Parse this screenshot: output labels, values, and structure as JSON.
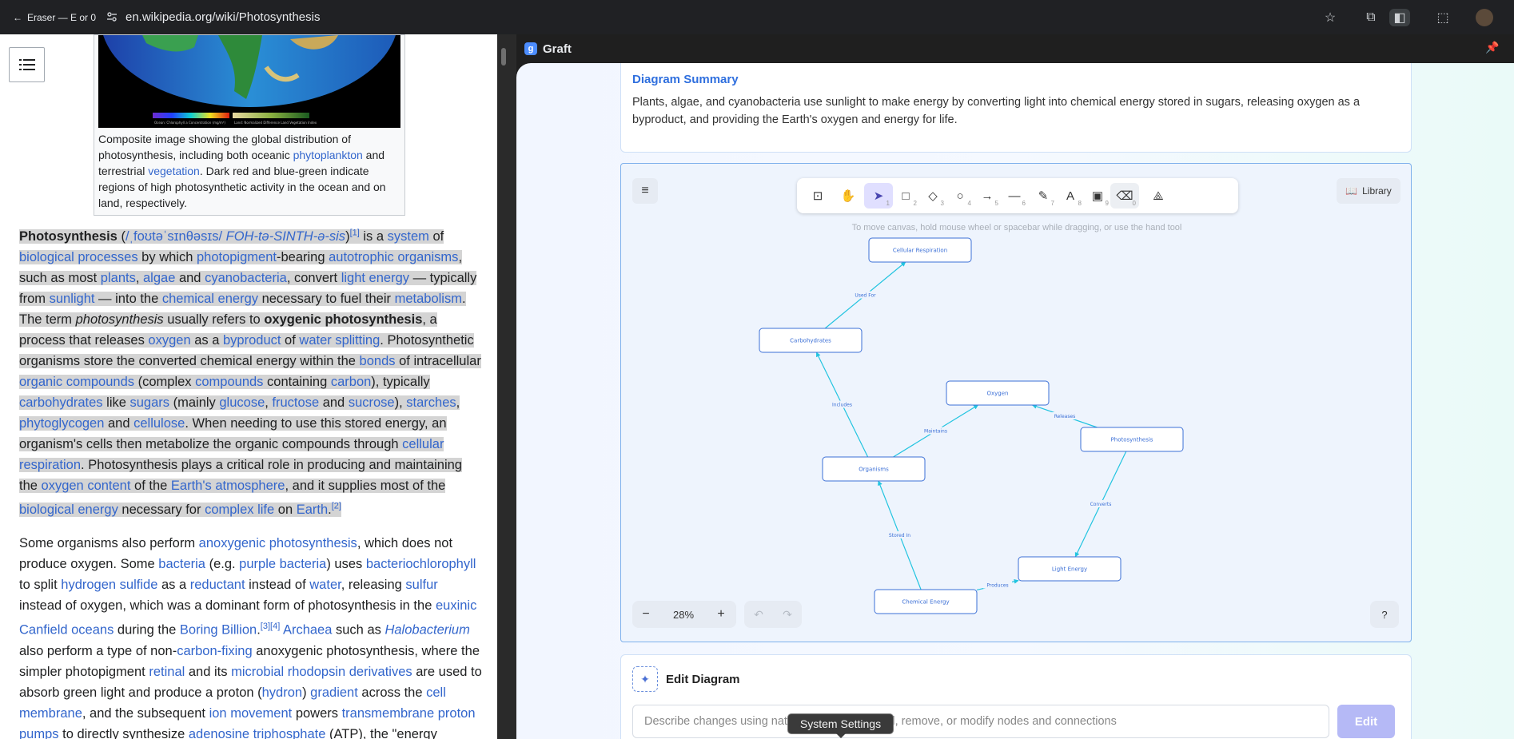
{
  "browser": {
    "tab_label": "Eraser — E or 0",
    "url": "en.wikipedia.org/wiki/Photosynthesis"
  },
  "wiki": {
    "caption": {
      "t1": "Composite image showing the global distribution of photosynthesis, including both oceanic ",
      "l1": "phytoplankton",
      "t2": " and terrestrial ",
      "l2": "vegetation",
      "t3": ". Dark red and blue-green indicate regions of high photosynthetic activity in the ocean and on land, respectively."
    },
    "legend_left": "Ocean: Chlorophyll a Concentration (mg/m³)",
    "legend_right": "Land: Normalized Difference Land Vegetation Index",
    "p1": [
      {
        "t": "b",
        "v": "Photosynthesis"
      },
      {
        "t": "s",
        "v": " ("
      },
      {
        "t": "a",
        "v": "/ˌfoʊtəˈsɪnθəsɪs/"
      },
      {
        "t": "s",
        "v": " "
      },
      {
        "t": "ai",
        "v": "FOH-tə-SINTH-ə-sis"
      },
      {
        "t": "s",
        "v": ")"
      },
      {
        "t": "sup",
        "v": "[1]"
      },
      {
        "t": "s",
        "v": " is a "
      },
      {
        "t": "a",
        "v": "system"
      },
      {
        "t": "s",
        "v": " of "
      },
      {
        "t": "a",
        "v": "biological processes"
      },
      {
        "t": "s",
        "v": " by which "
      },
      {
        "t": "a",
        "v": "photopigment"
      },
      {
        "t": "s",
        "v": "-bearing "
      },
      {
        "t": "a",
        "v": "autotrophic organisms"
      },
      {
        "t": "s",
        "v": ", such as most "
      },
      {
        "t": "a",
        "v": "plants"
      },
      {
        "t": "s",
        "v": ", "
      },
      {
        "t": "a",
        "v": "algae"
      },
      {
        "t": "s",
        "v": " and "
      },
      {
        "t": "a",
        "v": "cyanobacteria"
      },
      {
        "t": "s",
        "v": ", convert "
      },
      {
        "t": "a",
        "v": "light energy"
      },
      {
        "t": "s",
        "v": " — typically from "
      },
      {
        "t": "a",
        "v": "sunlight"
      },
      {
        "t": "s",
        "v": " — into the "
      },
      {
        "t": "a",
        "v": "chemical energy"
      },
      {
        "t": "s",
        "v": " necessary to fuel their "
      },
      {
        "t": "a",
        "v": "metabolism"
      },
      {
        "t": "s",
        "v": ". The term "
      },
      {
        "t": "i",
        "v": "photosynthesis"
      },
      {
        "t": "s",
        "v": " usually refers to "
      },
      {
        "t": "b",
        "v": "oxygenic photosynthesis"
      },
      {
        "t": "s",
        "v": ", a process that releases "
      },
      {
        "t": "a",
        "v": "oxygen"
      },
      {
        "t": "s",
        "v": " as a "
      },
      {
        "t": "a",
        "v": "byproduct"
      },
      {
        "t": "s",
        "v": " of "
      },
      {
        "t": "a",
        "v": "water splitting"
      },
      {
        "t": "s",
        "v": ". Photosynthetic organisms store the converted chemical energy within the "
      },
      {
        "t": "a",
        "v": "bonds"
      },
      {
        "t": "s",
        "v": " of intracellular "
      },
      {
        "t": "a",
        "v": "organic compounds"
      },
      {
        "t": "s",
        "v": " (complex "
      },
      {
        "t": "a",
        "v": "compounds"
      },
      {
        "t": "s",
        "v": " containing "
      },
      {
        "t": "a",
        "v": "carbon"
      },
      {
        "t": "s",
        "v": "), typically "
      },
      {
        "t": "a",
        "v": "carbohydrates"
      },
      {
        "t": "s",
        "v": " like "
      },
      {
        "t": "a",
        "v": "sugars"
      },
      {
        "t": "s",
        "v": " (mainly "
      },
      {
        "t": "a",
        "v": "glucose"
      },
      {
        "t": "s",
        "v": ", "
      },
      {
        "t": "a",
        "v": "fructose"
      },
      {
        "t": "s",
        "v": " and "
      },
      {
        "t": "a",
        "v": "sucrose"
      },
      {
        "t": "s",
        "v": "), "
      },
      {
        "t": "a",
        "v": "starches"
      },
      {
        "t": "s",
        "v": ", "
      },
      {
        "t": "a",
        "v": "phytoglycogen"
      },
      {
        "t": "s",
        "v": " and "
      },
      {
        "t": "a",
        "v": "cellulose"
      },
      {
        "t": "s",
        "v": ". When needing to use this stored energy, an organism's cells then metabolize the organic compounds through "
      },
      {
        "t": "a",
        "v": "cellular respiration"
      },
      {
        "t": "s",
        "v": ". Photosynthesis plays a critical role in producing and maintaining the "
      },
      {
        "t": "a",
        "v": "oxygen content"
      },
      {
        "t": "s",
        "v": " of the "
      },
      {
        "t": "a",
        "v": "Earth's atmosphere"
      },
      {
        "t": "s",
        "v": ", and it supplies most of the "
      },
      {
        "t": "a",
        "v": "biological energy"
      },
      {
        "t": "s",
        "v": " necessary for "
      },
      {
        "t": "a",
        "v": "complex life"
      },
      {
        "t": "s",
        "v": " on "
      },
      {
        "t": "a",
        "v": "Earth"
      },
      {
        "t": "s",
        "v": "."
      },
      {
        "t": "sup",
        "v": "[2]"
      }
    ],
    "p2": [
      {
        "t": "s",
        "v": "Some organisms also perform "
      },
      {
        "t": "a",
        "v": "anoxygenic photosynthesis"
      },
      {
        "t": "s",
        "v": ", which does not produce oxygen. Some "
      },
      {
        "t": "a",
        "v": "bacteria"
      },
      {
        "t": "s",
        "v": " (e.g. "
      },
      {
        "t": "a",
        "v": "purple bacteria"
      },
      {
        "t": "s",
        "v": ") uses "
      },
      {
        "t": "a",
        "v": "bacteriochlorophyll"
      },
      {
        "t": "s",
        "v": " to split "
      },
      {
        "t": "a",
        "v": "hydrogen sulfide"
      },
      {
        "t": "s",
        "v": " as a "
      },
      {
        "t": "a",
        "v": "reductant"
      },
      {
        "t": "s",
        "v": " instead of "
      },
      {
        "t": "a",
        "v": "water"
      },
      {
        "t": "s",
        "v": ", releasing "
      },
      {
        "t": "a",
        "v": "sulfur"
      },
      {
        "t": "s",
        "v": " instead of oxygen, which was a dominant form of photosynthesis in the "
      },
      {
        "t": "a",
        "v": "euxinic Canfield oceans"
      },
      {
        "t": "s",
        "v": " during the "
      },
      {
        "t": "a",
        "v": "Boring Billion"
      },
      {
        "t": "s",
        "v": "."
      },
      {
        "t": "sup",
        "v": "[3][4]"
      },
      {
        "t": "s",
        "v": " "
      },
      {
        "t": "a",
        "v": "Archaea"
      },
      {
        "t": "s",
        "v": " such as "
      },
      {
        "t": "ai",
        "v": "Halobacterium"
      },
      {
        "t": "s",
        "v": " also perform a type of non-"
      },
      {
        "t": "a",
        "v": "carbon-fixing"
      },
      {
        "t": "s",
        "v": " anoxygenic photosynthesis, where the simpler photopigment "
      },
      {
        "t": "a",
        "v": "retinal"
      },
      {
        "t": "s",
        "v": " and its "
      },
      {
        "t": "a",
        "v": "microbial rhodopsin derivatives"
      },
      {
        "t": "s",
        "v": " are used to absorb green light and produce a proton ("
      },
      {
        "t": "a",
        "v": "hydron"
      },
      {
        "t": "s",
        "v": ") "
      },
      {
        "t": "a",
        "v": "gradient"
      },
      {
        "t": "s",
        "v": " across the "
      },
      {
        "t": "a",
        "v": "cell membrane"
      },
      {
        "t": "s",
        "v": ", and the subsequent "
      },
      {
        "t": "a",
        "v": "ion movement"
      },
      {
        "t": "s",
        "v": " powers "
      },
      {
        "t": "a",
        "v": "transmembrane proton pumps"
      },
      {
        "t": "s",
        "v": " to directly synthesize "
      },
      {
        "t": "a",
        "v": "adenosine triphosphate"
      },
      {
        "t": "s",
        "v": " (ATP), the \"energy"
      }
    ]
  },
  "panel": {
    "title": "Graft",
    "summary_title": "Diagram Summary",
    "summary_text": "Plants, algae, and cyanobacteria use sunlight to make energy by converting light into chemical energy stored in sugars, releasing oxygen as a byproduct, and providing the Earth's oxygen and energy for life.",
    "library_label": "Library",
    "hint": "To move canvas, hold mouse wheel or spacebar while dragging, or use the hand tool",
    "zoom": "28%",
    "edit_title": "Edit Diagram",
    "edit_placeholder": "Describe changes using natural language — add, remove, or modify nodes and connections",
    "edit_button": "Edit",
    "tooltip": "System Settings",
    "tools": [
      {
        "icon": "lock-icon",
        "glyph": "⊡",
        "key": ""
      },
      {
        "icon": "hand-icon",
        "glyph": "✋",
        "key": ""
      },
      {
        "icon": "selection-icon",
        "glyph": "➤",
        "key": "1"
      },
      {
        "icon": "rectangle-icon",
        "glyph": "□",
        "key": "2"
      },
      {
        "icon": "diamond-icon",
        "glyph": "◇",
        "key": "3"
      },
      {
        "icon": "ellipse-icon",
        "glyph": "○",
        "key": "4"
      },
      {
        "icon": "arrow-icon",
        "glyph": "→",
        "key": "5"
      },
      {
        "icon": "line-icon",
        "glyph": "—",
        "key": "6"
      },
      {
        "icon": "pencil-icon",
        "glyph": "✎",
        "key": "7"
      },
      {
        "icon": "text-icon",
        "glyph": "A",
        "key": "8"
      },
      {
        "icon": "image-icon",
        "glyph": "▣",
        "key": "9"
      },
      {
        "icon": "eraser-icon",
        "glyph": "⌫",
        "key": "0"
      },
      {
        "icon": "shapes-icon",
        "glyph": "⟁",
        "key": ""
      }
    ],
    "nodes": [
      {
        "id": "cr",
        "label": "Cellular Respiration"
      },
      {
        "id": "carb",
        "label": "Carbohydrates"
      },
      {
        "id": "oxy",
        "label": "Oxygen"
      },
      {
        "id": "photo",
        "label": "Photosynthesis"
      },
      {
        "id": "org",
        "label": "Organisms"
      },
      {
        "id": "light",
        "label": "Light Energy"
      },
      {
        "id": "chem",
        "label": "Chemical Energy"
      }
    ],
    "edges": [
      {
        "from": "carb",
        "to": "cr",
        "label": "Used For"
      },
      {
        "from": "org",
        "to": "carb",
        "label": "Includes"
      },
      {
        "from": "org",
        "to": "oxy",
        "label": "Maintains"
      },
      {
        "from": "photo",
        "to": "oxy",
        "label": "Releases"
      },
      {
        "from": "photo",
        "to": "light",
        "label": "Converts"
      },
      {
        "from": "chem",
        "to": "light",
        "label": "Produces"
      },
      {
        "from": "chem",
        "to": "org",
        "label": "Stored In"
      }
    ],
    "colors": {
      "accent": "#2f6fde",
      "edge": "#22c4e0",
      "node_stroke": "#3b6fd6"
    }
  }
}
